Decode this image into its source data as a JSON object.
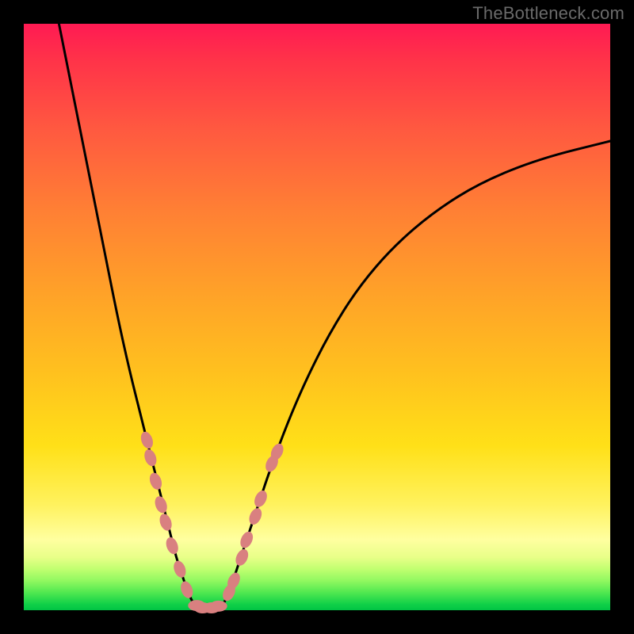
{
  "watermark": "TheBottleneck.com",
  "colors": {
    "curve": "#000000",
    "marker_fill": "#d98080",
    "marker_stroke": "#a05050"
  },
  "chart_data": {
    "type": "line",
    "title": "",
    "xlabel": "",
    "ylabel": "",
    "xlim": [
      0,
      100
    ],
    "ylim": [
      0,
      100
    ],
    "series": [
      {
        "name": "curve-left",
        "x": [
          6,
          8,
          10,
          12,
          14,
          16,
          18,
          20,
          21,
          22,
          23,
          24,
          25,
          26,
          27,
          28,
          29
        ],
        "y": [
          100,
          90,
          80,
          70,
          60,
          50,
          41,
          33,
          29,
          25,
          21,
          17,
          13,
          9,
          6,
          3,
          1
        ]
      },
      {
        "name": "curve-flat",
        "x": [
          29,
          30,
          31,
          32,
          33,
          34
        ],
        "y": [
          1,
          0.5,
          0.3,
          0.3,
          0.5,
          1
        ]
      },
      {
        "name": "curve-right",
        "x": [
          34,
          35,
          36,
          37,
          38,
          40,
          42,
          45,
          48,
          52,
          57,
          63,
          70,
          78,
          88,
          100
        ],
        "y": [
          1,
          3,
          6,
          9,
          12,
          18,
          24,
          32,
          39,
          47,
          55,
          62,
          68,
          73,
          77,
          80
        ]
      }
    ],
    "markers": [
      {
        "series": "left",
        "x": 21.0,
        "y": 29
      },
      {
        "series": "left",
        "x": 21.6,
        "y": 26
      },
      {
        "series": "left",
        "x": 22.5,
        "y": 22
      },
      {
        "series": "left",
        "x": 23.4,
        "y": 18
      },
      {
        "series": "left",
        "x": 24.2,
        "y": 15
      },
      {
        "series": "left",
        "x": 25.3,
        "y": 11
      },
      {
        "series": "left",
        "x": 26.6,
        "y": 7
      },
      {
        "series": "left",
        "x": 27.8,
        "y": 3.5
      },
      {
        "series": "flat",
        "x": 29.5,
        "y": 0.8
      },
      {
        "series": "flat",
        "x": 30.5,
        "y": 0.4
      },
      {
        "series": "flat",
        "x": 32.0,
        "y": 0.4
      },
      {
        "series": "flat",
        "x": 33.2,
        "y": 0.7
      },
      {
        "series": "right",
        "x": 35.0,
        "y": 3
      },
      {
        "series": "right",
        "x": 35.8,
        "y": 5
      },
      {
        "series": "right",
        "x": 37.2,
        "y": 9
      },
      {
        "series": "right",
        "x": 38.0,
        "y": 12
      },
      {
        "series": "right",
        "x": 39.5,
        "y": 16
      },
      {
        "series": "right",
        "x": 40.4,
        "y": 19
      },
      {
        "series": "right",
        "x": 42.3,
        "y": 25
      },
      {
        "series": "right",
        "x": 43.2,
        "y": 27
      }
    ]
  }
}
